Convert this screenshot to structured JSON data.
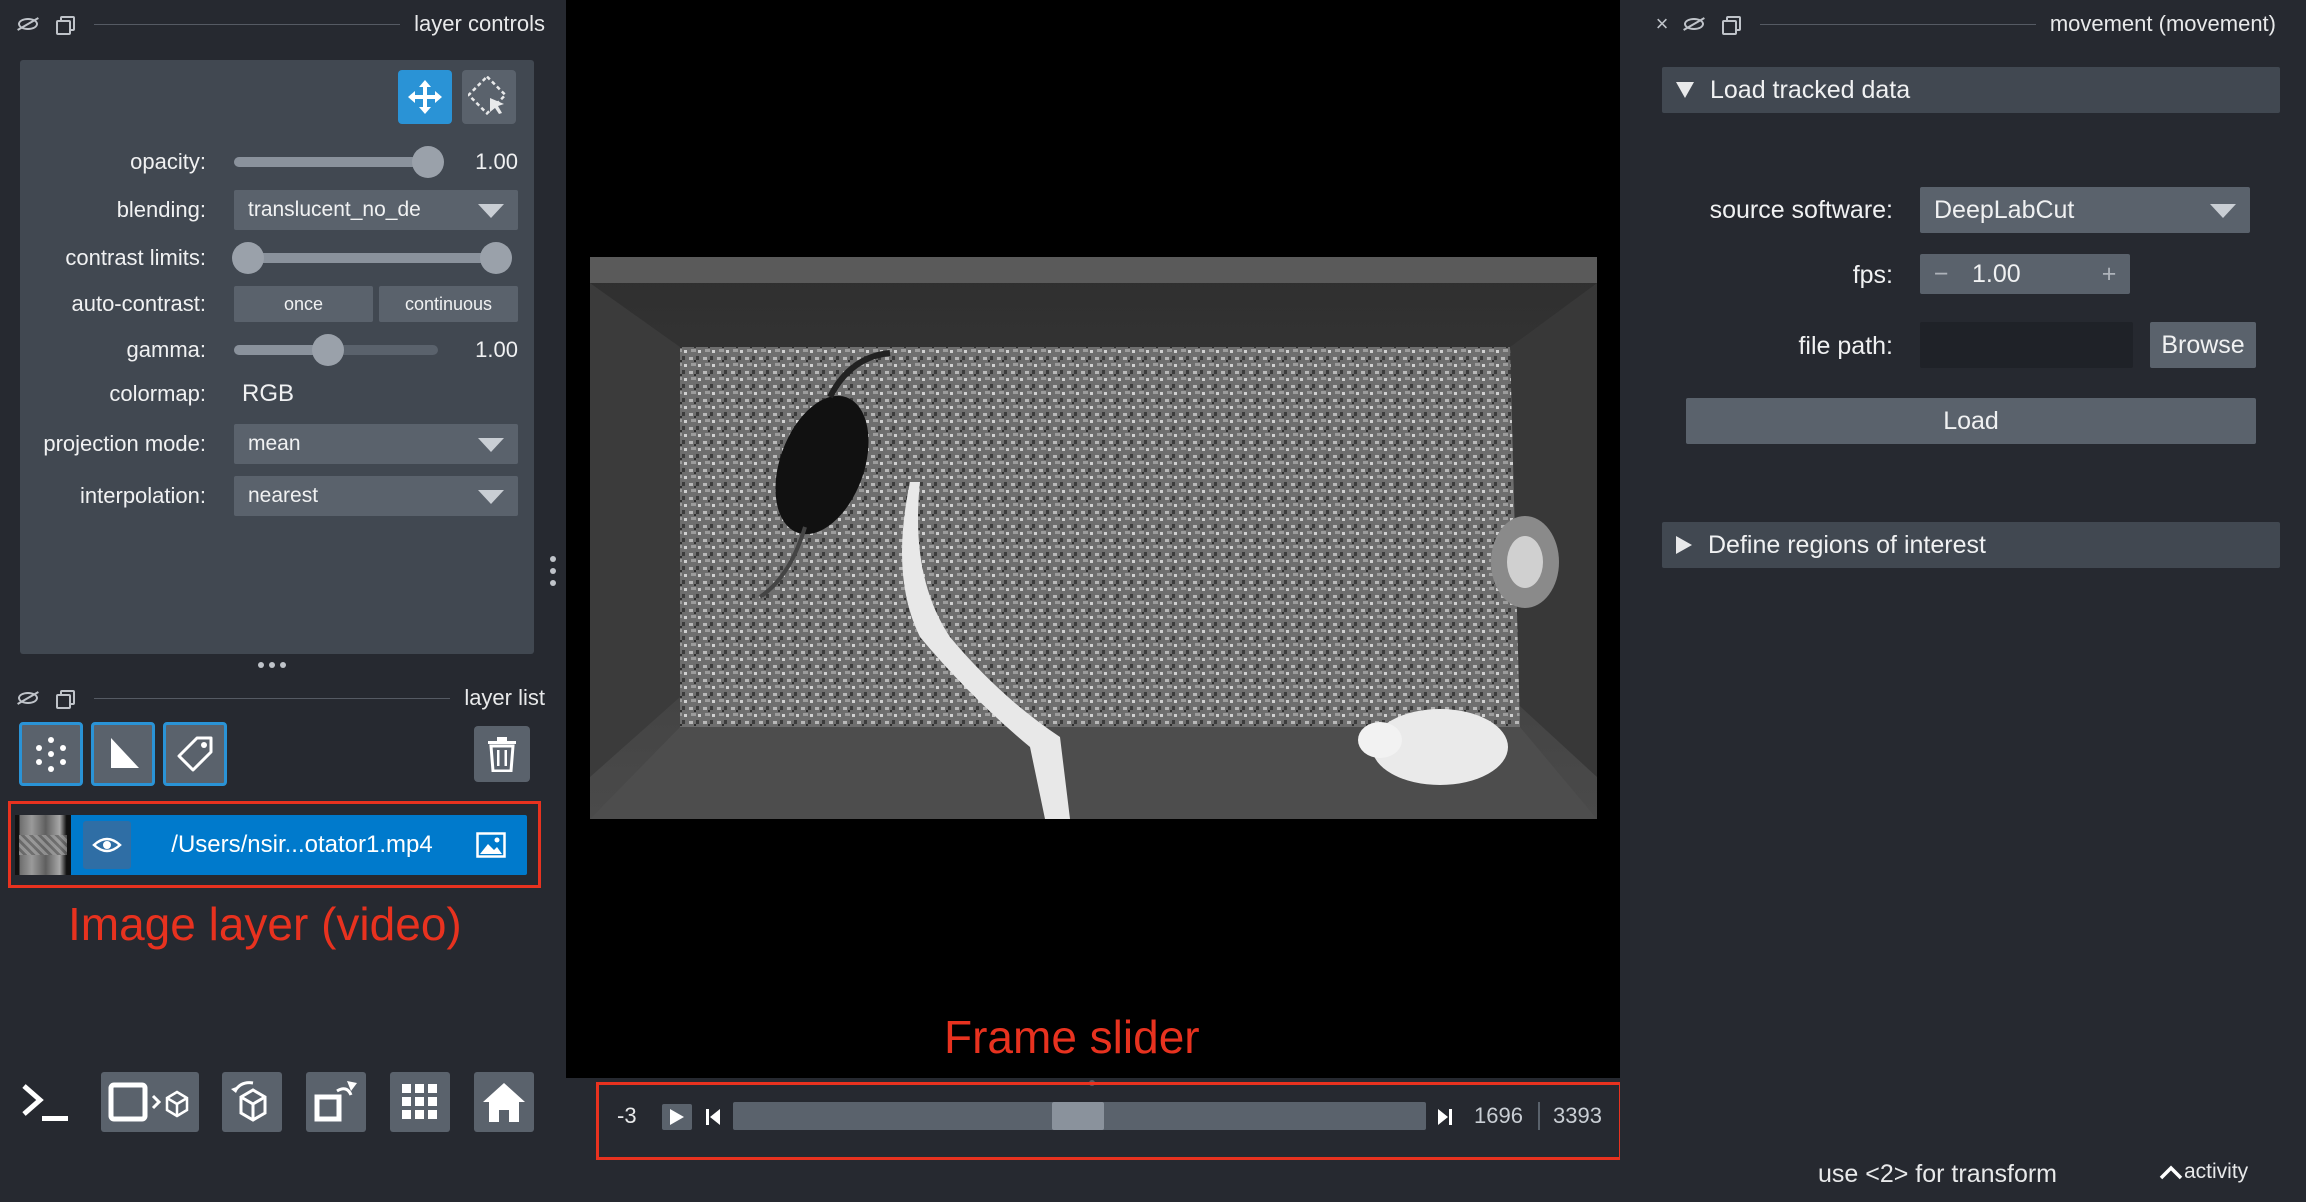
{
  "layer_controls": {
    "title": "layer controls",
    "opacity": {
      "label": "opacity:",
      "value": "1.00"
    },
    "blending": {
      "label": "blending:",
      "value": "translucent_no_de"
    },
    "contrast_limits": {
      "label": "contrast limits:"
    },
    "auto_contrast": {
      "label": "auto-contrast:",
      "once": "once",
      "continuous": "continuous"
    },
    "gamma": {
      "label": "gamma:",
      "value": "1.00"
    },
    "colormap": {
      "label": "colormap:",
      "value": "RGB"
    },
    "projection_mode": {
      "label": "projection mode:",
      "value": "mean"
    },
    "interpolation": {
      "label": "interpolation:",
      "value": "nearest"
    }
  },
  "layer_list": {
    "title": "layer list",
    "layers": [
      {
        "name": "/Users/nsir...otator1.mp4",
        "type": "image",
        "visible": true,
        "selected": true
      }
    ]
  },
  "annotations": {
    "image_layer": "Image layer (video)",
    "frame_slider": "Frame slider"
  },
  "dims": {
    "axis_index": "-3",
    "current_frame": "1696",
    "total_frames": "3393",
    "slider_fraction": 0.5
  },
  "plugin": {
    "title": "movement (movement)",
    "load_section": {
      "title": "Load tracked data",
      "source_software_label": "source software:",
      "source_software_value": "DeepLabCut",
      "fps_label": "fps:",
      "fps_value": "1.00",
      "fps_minus": "−",
      "fps_plus": "+",
      "file_path_label": "file path:",
      "file_path_value": "",
      "browse_label": "Browse",
      "load_label": "Load"
    },
    "roi_section": {
      "title": "Define regions of interest"
    }
  },
  "status": {
    "message": "use <2> for transform",
    "activity": "activity"
  },
  "colors": {
    "background": "#262930",
    "panel": "#414851",
    "widget": "#5a626c",
    "accent": "#007acc",
    "annotation_red": "#e8321f"
  }
}
